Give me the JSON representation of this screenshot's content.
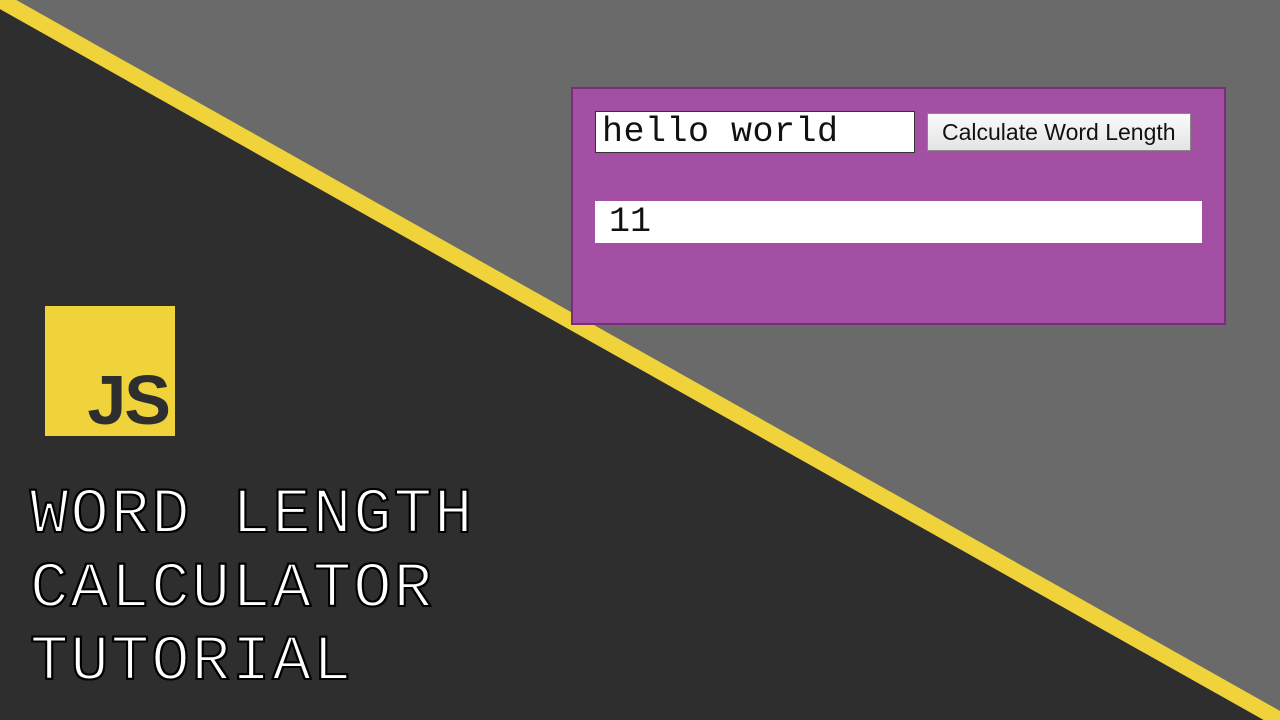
{
  "colors": {
    "grey": "#6a6a6a",
    "dark": "#2e2e2e",
    "yellow": "#f0d33b",
    "panel": "#a34fa3"
  },
  "logo": {
    "text": "JS"
  },
  "headline": {
    "line1": "WORD LENGTH",
    "line2": "CALCULATOR",
    "line3": "TUTORIAL"
  },
  "demo": {
    "input_value": "hello world",
    "button_label": "Calculate Word Length",
    "output_value": "11"
  }
}
